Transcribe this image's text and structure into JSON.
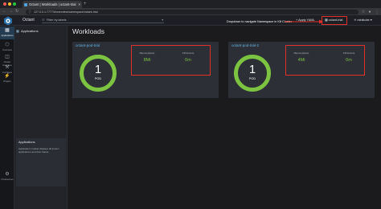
{
  "browser": {
    "tab_title": "Octant | Workloads | octant-trial",
    "tab_close": "×",
    "new_tab": "+",
    "url": "127.0.0.1:7777/#/overview/namespace/octant-trial"
  },
  "header": {
    "app_name": "Octant",
    "filter_placeholder": "Filter by labels",
    "apply_yaml_label": "Apply YAML",
    "namespace_value": "octant-trial",
    "context_label": "minikube",
    "callout_text": "Dropdown to navigate Namespace in K8 Cluster"
  },
  "rail": {
    "items": [
      {
        "label": "Applications",
        "icon": "grid-icon"
      },
      {
        "label": "Overview",
        "icon": "cube-icon"
      },
      {
        "label": "Cluster Overview",
        "icon": "cluster-icon"
      },
      {
        "label": "Configure",
        "icon": "wrench-icon"
      },
      {
        "label": "Plugins",
        "icon": "plug-icon"
      }
    ],
    "preferences_label": "Preferences"
  },
  "nav": {
    "heading": "Applications",
    "info_title": "Applications",
    "info_text": "Application module displays all known applications and their status."
  },
  "main": {
    "title": "Workloads",
    "cards": [
      {
        "name": "octant-pod-trial",
        "count": "1",
        "unit": "POD",
        "memory_label": "Memory(bytes)",
        "memory_value": "8Mi",
        "cpu_label": "CPU(cores)",
        "cpu_value": "0m"
      },
      {
        "name": "octant-pod-trial-2",
        "count": "1",
        "unit": "POD",
        "memory_label": "Memory(bytes)",
        "memory_value": "4Mi",
        "cpu_label": "CPU(cores)",
        "cpu_value": "0m"
      }
    ]
  },
  "colors": {
    "accent_green": "#7cc341",
    "link_blue": "#60b3e8",
    "highlight_red": "#e0302a"
  }
}
